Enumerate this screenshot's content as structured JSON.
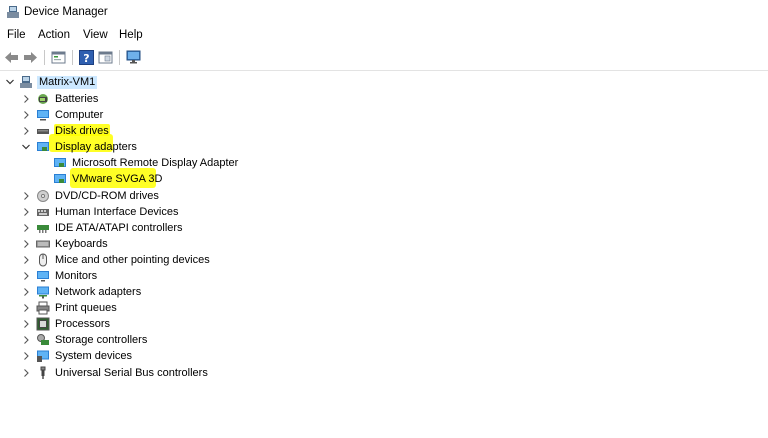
{
  "window": {
    "title": "Device Manager"
  },
  "menu": [
    "File",
    "Action",
    "View",
    "Help"
  ],
  "toolbar": {
    "buttons": [
      "back-arrow-icon",
      "forward-arrow-icon",
      "properties-icon",
      "help-icon",
      "details-view-icon",
      "monitor-scan-icon"
    ]
  },
  "tree": {
    "root": "Matrix-VM1",
    "categories": [
      {
        "label": "Batteries",
        "icon": "battery-icon",
        "expanded": false
      },
      {
        "label": "Computer",
        "icon": "computer-icon",
        "expanded": false
      },
      {
        "label": "Disk drives",
        "icon": "disk-drive-icon",
        "expanded": false
      },
      {
        "label": "Display adapters",
        "icon": "display-adapter-icon",
        "expanded": true,
        "children": [
          "Microsoft Remote Display Adapter",
          "VMware SVGA 3D"
        ]
      },
      {
        "label": "DVD/CD-ROM drives",
        "icon": "dvd-icon",
        "expanded": false
      },
      {
        "label": "Human Interface Devices",
        "icon": "hid-icon",
        "expanded": false
      },
      {
        "label": "IDE ATA/ATAPI controllers",
        "icon": "ide-controller-icon",
        "expanded": false
      },
      {
        "label": "Keyboards",
        "icon": "keyboard-icon",
        "expanded": false
      },
      {
        "label": "Mice and other pointing devices",
        "icon": "mouse-icon",
        "expanded": false
      },
      {
        "label": "Monitors",
        "icon": "monitor-icon",
        "expanded": false
      },
      {
        "label": "Network adapters",
        "icon": "network-adapter-icon",
        "expanded": false
      },
      {
        "label": "Print queues",
        "icon": "printer-icon",
        "expanded": false
      },
      {
        "label": "Processors",
        "icon": "processor-icon",
        "expanded": false
      },
      {
        "label": "Storage controllers",
        "icon": "storage-controller-icon",
        "expanded": false
      },
      {
        "label": "System devices",
        "icon": "system-devices-icon",
        "expanded": false
      },
      {
        "label": "Universal Serial Bus controllers",
        "icon": "usb-icon",
        "expanded": false
      }
    ]
  },
  "colors": {
    "highlight": "#ffff00",
    "selection": "#cce8ff"
  }
}
